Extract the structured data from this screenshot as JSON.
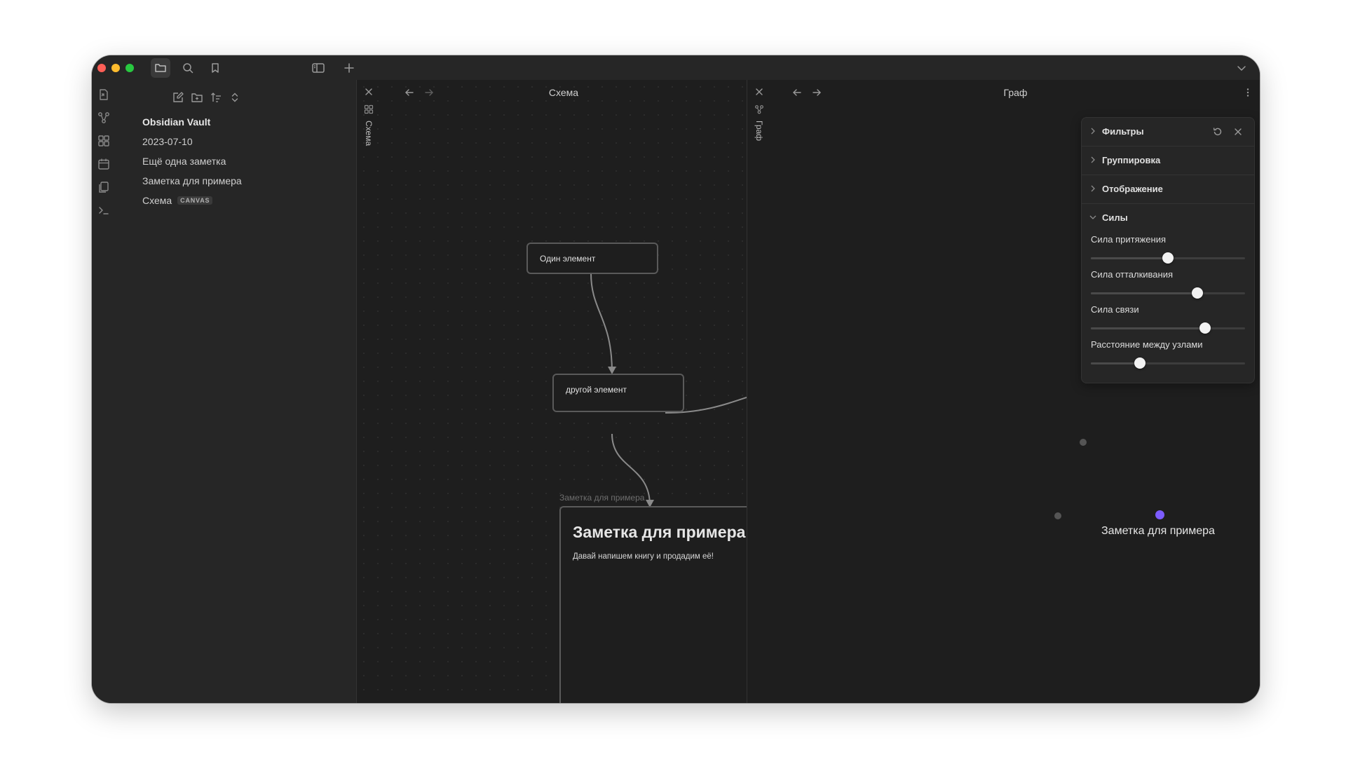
{
  "titlebar": {
    "icons": [
      "folder-icon",
      "search-icon",
      "bookmark-icon",
      "sidebar-toggle-icon",
      "new-tab-icon",
      "chevron-down-icon"
    ]
  },
  "ribbon": {
    "icons": [
      "open-quick-switcher-icon",
      "graph-view-icon",
      "canvas-icon",
      "daily-note-icon",
      "templates-icon",
      "command-palette-icon"
    ]
  },
  "sidebar": {
    "tools": [
      "new-note-icon",
      "new-folder-icon",
      "sort-icon",
      "collapse-icon"
    ],
    "vault_name": "Obsidian Vault",
    "files": [
      {
        "name": "2023-07-10"
      },
      {
        "name": "Ещё одна заметка"
      },
      {
        "name": "Заметка для примера"
      },
      {
        "name": "Схема",
        "badge": "CANVAS"
      }
    ]
  },
  "canvas_pane": {
    "title": "Схема",
    "strip_title": "Схема",
    "nodes": {
      "node1": "Один элемент",
      "node2": "другой элемент"
    },
    "file_node": {
      "label": "Заметка для примера",
      "heading": "Заметка для примера",
      "body": "Давай напишем книгу и продадим её!"
    }
  },
  "graph_pane": {
    "title": "Граф",
    "strip_title": "Граф",
    "node_label": "Заметка для примера",
    "accent_color": "#7c5cff",
    "settings": {
      "sections": [
        {
          "label": "Фильтры",
          "expanded": false
        },
        {
          "label": "Группировка",
          "expanded": false
        },
        {
          "label": "Отображение",
          "expanded": false
        },
        {
          "label": "Силы",
          "expanded": true
        }
      ],
      "sliders": [
        {
          "label": "Сила притяжения",
          "value": 0.5
        },
        {
          "label": "Сила отталкивания",
          "value": 0.69
        },
        {
          "label": "Сила связи",
          "value": 0.74
        },
        {
          "label": "Расстояние между узлами",
          "value": 0.32
        }
      ]
    }
  }
}
